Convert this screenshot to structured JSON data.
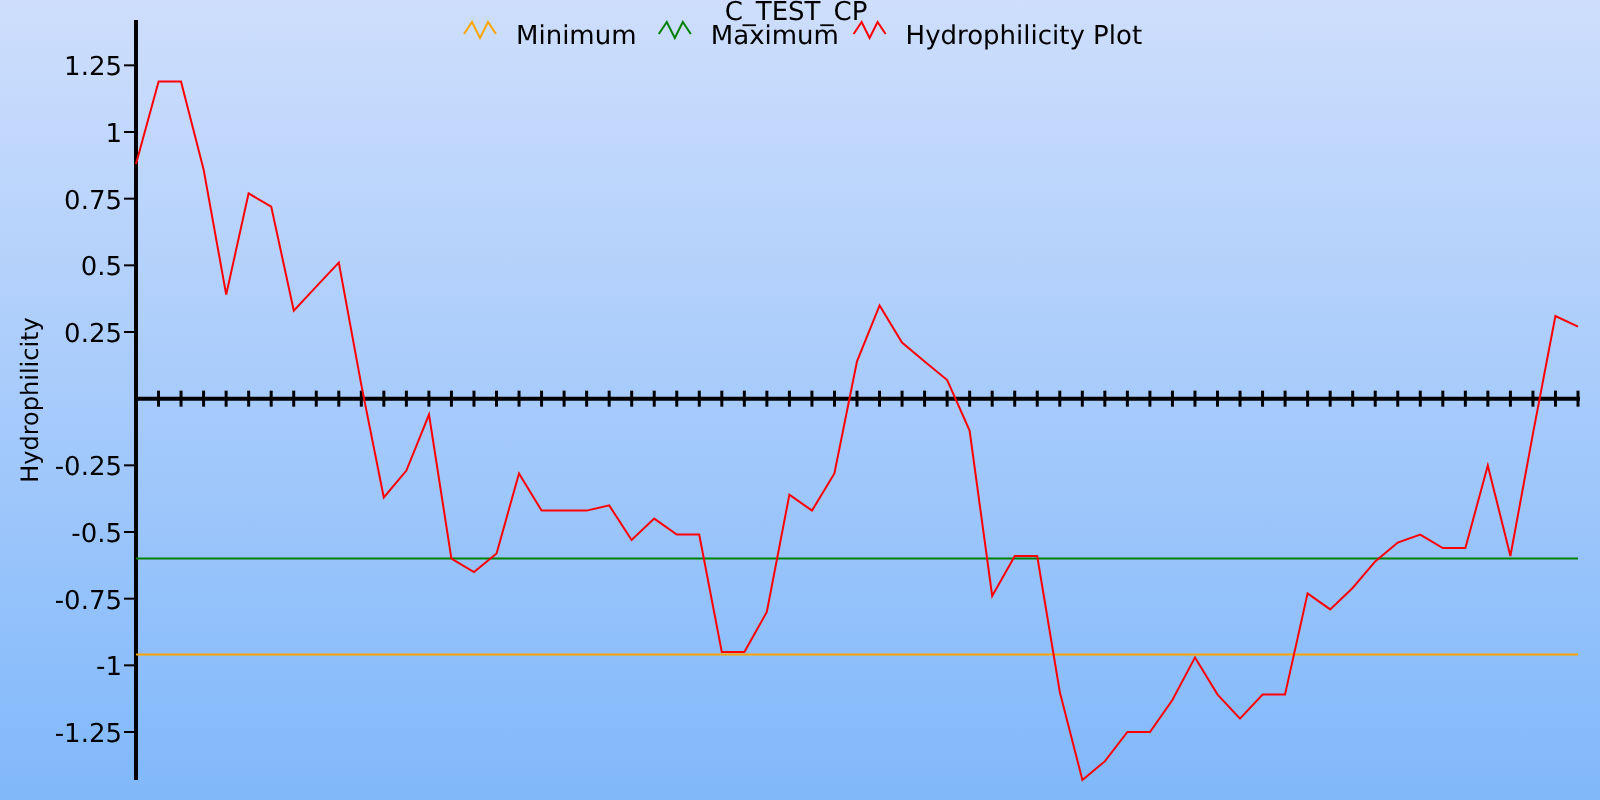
{
  "chart": {
    "chart_data": {
      "type": "line",
      "title": "C_TEST_CP",
      "ylabel": "Hydrophilicity",
      "categories": [
        null,
        null,
        null,
        null,
        null,
        null,
        null,
        null,
        null,
        null,
        null,
        null,
        null,
        null,
        null,
        null,
        null,
        null,
        null,
        null,
        null,
        null,
        null,
        null,
        null,
        null,
        null,
        null,
        null,
        null,
        null,
        null,
        null,
        null,
        null,
        null,
        null,
        null,
        null,
        null,
        null,
        null,
        null,
        null,
        null,
        null,
        null,
        null,
        null,
        null,
        null,
        null,
        null,
        null,
        null,
        null,
        null,
        null,
        null,
        null,
        null,
        null,
        null,
        null,
        null
      ],
      "ylim": [
        -1.43,
        1.42
      ],
      "legend": "top",
      "yticks": [
        {
          "value": -1.25,
          "label": "-1.25"
        },
        {
          "value": -1,
          "label": "-1"
        },
        {
          "value": -0.75,
          "label": "-0.75"
        },
        {
          "value": -0.5,
          "label": "-0.5"
        },
        {
          "value": -0.25,
          "label": "-0.25"
        },
        {
          "value": 0.25,
          "label": "0.25"
        },
        {
          "value": 0.5,
          "label": "0.5"
        },
        {
          "value": 0.75,
          "label": "0.75"
        },
        {
          "value": 1,
          "label": "1"
        },
        {
          "value": 1.25,
          "label": "1.25"
        }
      ],
      "series": [
        {
          "name": "Minimum",
          "color": "#ffa500",
          "values": [
            -0.96,
            -0.96,
            -0.96,
            -0.96,
            -0.96,
            -0.96,
            -0.96,
            -0.96,
            -0.96,
            -0.96,
            -0.96,
            -0.96,
            -0.96,
            -0.96,
            -0.96,
            -0.96,
            -0.96,
            -0.96,
            -0.96,
            -0.96,
            -0.96,
            -0.96,
            -0.96,
            -0.96,
            -0.96,
            -0.96,
            -0.96,
            -0.96,
            -0.96,
            -0.96,
            -0.96,
            -0.96,
            -0.96,
            -0.96,
            -0.96,
            -0.96,
            -0.96,
            -0.96,
            -0.96,
            -0.96,
            -0.96,
            -0.96,
            -0.96,
            -0.96,
            -0.96,
            -0.96,
            -0.96,
            -0.96,
            -0.96,
            -0.96,
            -0.96,
            -0.96,
            -0.96,
            -0.96,
            -0.96,
            -0.96,
            -0.96,
            -0.96,
            -0.96,
            -0.96,
            -0.96,
            -0.96,
            -0.96,
            -0.96,
            -0.96
          ]
        },
        {
          "name": "Maximum",
          "color": "#008000",
          "values": [
            -0.6,
            -0.6,
            -0.6,
            -0.6,
            -0.6,
            -0.6,
            -0.6,
            -0.6,
            -0.6,
            -0.6,
            -0.6,
            -0.6,
            -0.6,
            -0.6,
            -0.6,
            -0.6,
            -0.6,
            -0.6,
            -0.6,
            -0.6,
            -0.6,
            -0.6,
            -0.6,
            -0.6,
            -0.6,
            -0.6,
            -0.6,
            -0.6,
            -0.6,
            -0.6,
            -0.6,
            -0.6,
            -0.6,
            -0.6,
            -0.6,
            -0.6,
            -0.6,
            -0.6,
            -0.6,
            -0.6,
            -0.6,
            -0.6,
            -0.6,
            -0.6,
            -0.6,
            -0.6,
            -0.6,
            -0.6,
            -0.6,
            -0.6,
            -0.6,
            -0.6,
            -0.6,
            -0.6,
            -0.6,
            -0.6,
            -0.6,
            -0.6,
            -0.6,
            -0.6,
            -0.6,
            -0.6,
            -0.6,
            -0.6,
            -0.6
          ]
        },
        {
          "name": "Hydrophilicity Plot",
          "color": "#ff0000",
          "values": [
            0.88,
            1.19,
            1.19,
            0.86,
            0.39,
            0.77,
            0.72,
            0.33,
            0.42,
            0.51,
            0.05,
            -0.37,
            -0.27,
            -0.06,
            -0.6,
            -0.65,
            -0.58,
            -0.28,
            -0.42,
            -0.42,
            -0.42,
            -0.4,
            -0.53,
            -0.45,
            -0.51,
            -0.51,
            -0.95,
            -0.95,
            -0.8,
            -0.36,
            -0.42,
            -0.28,
            0.14,
            0.35,
            0.21,
            0.14,
            0.07,
            -0.12,
            -0.74,
            -0.59,
            -0.59,
            -1.1,
            -1.43,
            -1.36,
            -1.25,
            -1.25,
            -1.13,
            -0.97,
            -1.11,
            -1.2,
            -1.11,
            -1.11,
            -0.73,
            -0.79,
            -0.71,
            -0.61,
            -0.54,
            -0.51,
            -0.56,
            -0.56,
            -0.25,
            -0.59,
            -0.13,
            0.31,
            0.27
          ]
        }
      ]
    }
  }
}
